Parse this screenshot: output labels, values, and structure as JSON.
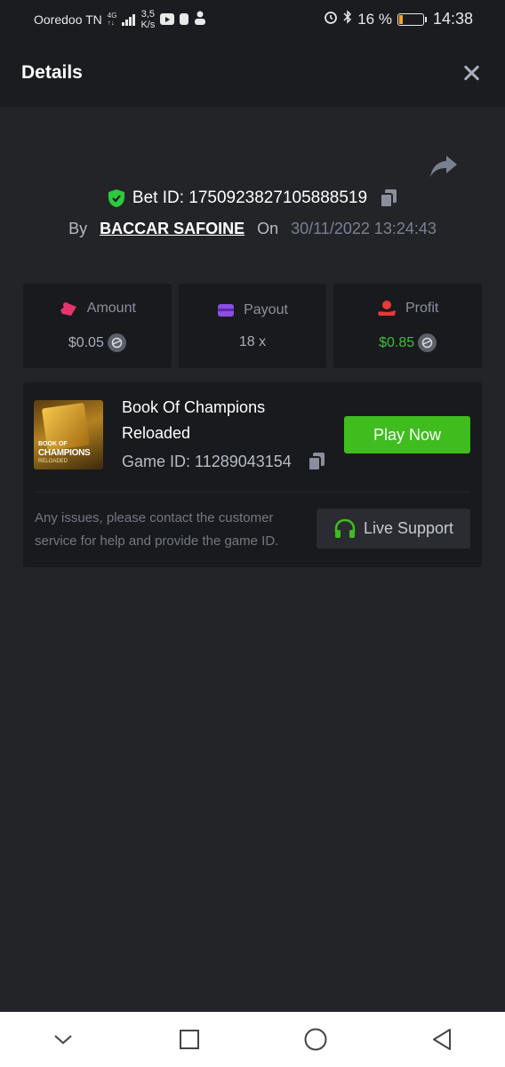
{
  "status_bar": {
    "carrier": "Ooredoo TN",
    "network": "4G",
    "speed_value": "3,5",
    "speed_unit": "K/s",
    "battery": "16 %",
    "battery_level": 0.16,
    "time": "14:38",
    "icons": [
      "signal-icon",
      "youtube-icon",
      "battery-saver-icon",
      "user-icon",
      "alarm-icon",
      "bluetooth-icon",
      "battery-icon"
    ]
  },
  "header": {
    "title": "Details",
    "close_icon": "close-icon"
  },
  "bet": {
    "id_label": "Bet ID: 1750923827105888519",
    "by_label": "By",
    "user": "BACCAR SAFOINE",
    "on_label": "On",
    "datetime": "30/11/2022 13:24:43"
  },
  "stats": [
    {
      "label": "Amount",
      "value": "$0.05",
      "icon": "amount-icon",
      "color": "#e6356e"
    },
    {
      "label": "Payout",
      "value": "18 x",
      "icon": "wallet-icon",
      "color": "#8b4ee6"
    },
    {
      "label": "Profit",
      "value": "$0.85",
      "icon": "profit-icon",
      "color": "#e83a3a"
    }
  ],
  "game": {
    "name": "Book Of Champions Reloaded",
    "thumb_line1": "BOOK OF",
    "thumb_line2": "CHAMPIONS",
    "thumb_line3": "RELOADED",
    "id_label": "Game ID: 11289043154",
    "play_label": "Play Now",
    "help_text": "Any issues, please contact the customer service for help and provide the game ID.",
    "support_label": "Live Support"
  },
  "colors": {
    "background": "#232428",
    "panel": "#191a1e",
    "accent_green": "#3fbd1f",
    "shield_green": "#2fc93c"
  },
  "navbar": {
    "icons": [
      "chevron-down-icon",
      "recent-apps-icon",
      "home-icon",
      "back-icon"
    ]
  }
}
